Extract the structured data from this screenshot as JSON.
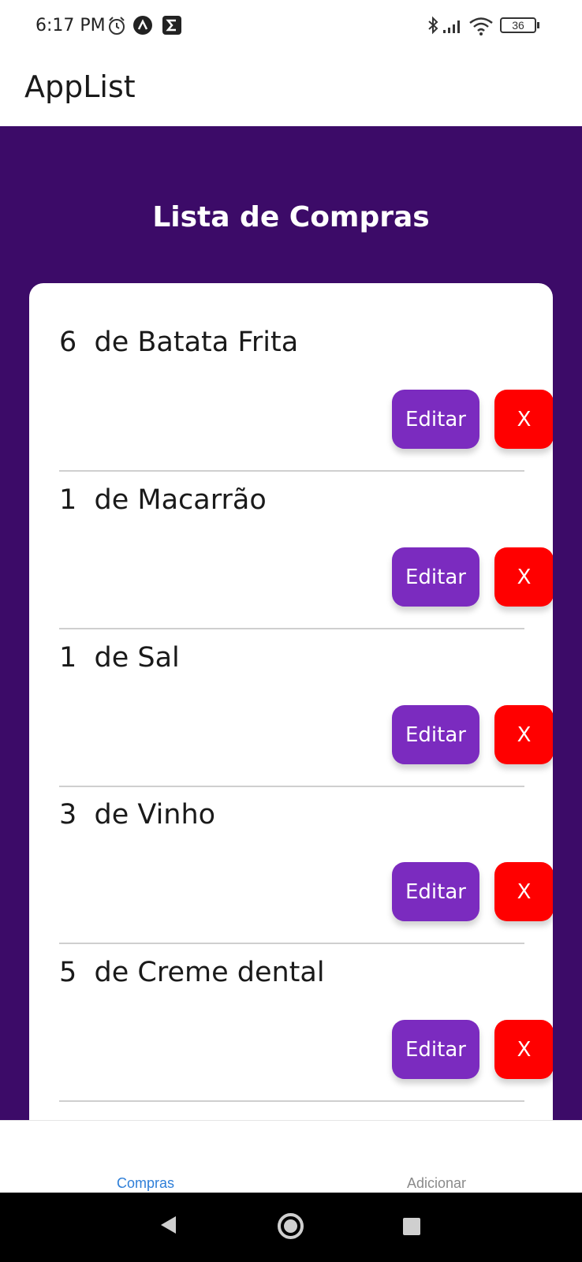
{
  "status": {
    "time": "6:17 PM",
    "battery": "36",
    "icons": [
      "alarm-icon",
      "app-a-icon",
      "sigma-icon",
      "bluetooth-icon",
      "signal-icon",
      "wifi-icon",
      "battery-icon"
    ]
  },
  "app": {
    "title": "AppList"
  },
  "screen": {
    "title": "Lista de Compras"
  },
  "items": [
    {
      "text": "6  de Batata Frita",
      "edit_label": "Editar",
      "delete_label": "X"
    },
    {
      "text": "1  de Macarrão",
      "edit_label": "Editar",
      "delete_label": "X"
    },
    {
      "text": "1  de Sal",
      "edit_label": "Editar",
      "delete_label": "X"
    },
    {
      "text": "3  de Vinho",
      "edit_label": "Editar",
      "delete_label": "X"
    },
    {
      "text": "5  de Creme dental",
      "edit_label": "Editar",
      "delete_label": "X"
    }
  ],
  "tabs": [
    {
      "label": "Compras",
      "active": true
    },
    {
      "label": "Adicionar",
      "active": false
    }
  ],
  "colors": {
    "header_bg": "#3c0b68",
    "edit_button": "#7b2bbf",
    "delete_button": "#ff0000",
    "active_tab": "#2f7fd8"
  }
}
